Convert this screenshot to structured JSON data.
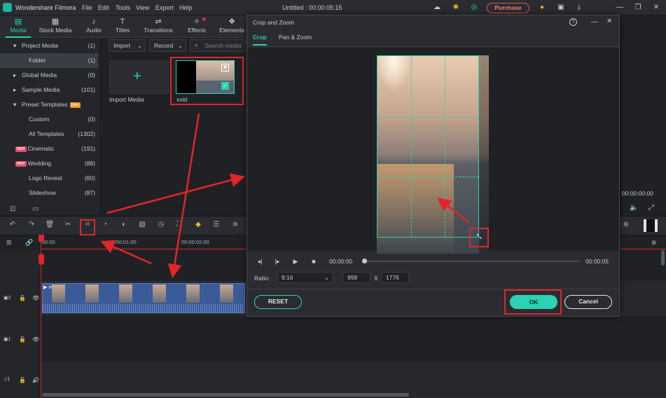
{
  "app": {
    "name": "Wondershare Filmora",
    "title": "Untitled : 00:00:05:15",
    "purchase": "Purchase"
  },
  "menu": [
    "File",
    "Edit",
    "Tools",
    "View",
    "Export",
    "Help"
  ],
  "tabs": [
    {
      "label": "Media",
      "icon": "folder-icon"
    },
    {
      "label": "Stock Media",
      "icon": "stock-icon"
    },
    {
      "label": "Audio",
      "icon": "music-icon"
    },
    {
      "label": "Titles",
      "icon": "text-icon"
    },
    {
      "label": "Transitions",
      "icon": "transition-icon"
    },
    {
      "label": "Effects",
      "icon": "effects-icon"
    },
    {
      "label": "Elements",
      "icon": "elements-icon"
    }
  ],
  "sidebar": [
    {
      "label": "Project Media",
      "count": "(1)"
    },
    {
      "label": "Folder",
      "count": "(1)"
    },
    {
      "label": "Global Media",
      "count": "(0)"
    },
    {
      "label": "Sample Media",
      "count": "(101)"
    },
    {
      "label": "Preset Templates",
      "count": "",
      "badge": "New"
    },
    {
      "label": "Custom",
      "count": "(0)"
    },
    {
      "label": "All Templates",
      "count": "(1302)"
    },
    {
      "label": "Cinematic",
      "count": "(191)",
      "badge": "HOT"
    },
    {
      "label": "Wedding",
      "count": "(88)",
      "badge": "HOT"
    },
    {
      "label": "Logo Reveal",
      "count": "(60)"
    },
    {
      "label": "Slideshow",
      "count": "(87)"
    }
  ],
  "media": {
    "import_label": "Import",
    "record_label": "Record",
    "search_placeholder": "Search media",
    "import_tile": "Import Media",
    "clip_name": "xvid"
  },
  "preview": {
    "time": "00:00:00:00"
  },
  "timeline": {
    "marks": [
      "00:00",
      "00:00:01:00",
      "00:00:02:00"
    ],
    "clip_name": "xvid",
    "tracks": [
      "2",
      "1",
      "1"
    ]
  },
  "dialog": {
    "title": "Crop and Zoom",
    "tab_crop": "Crop",
    "tab_pan": "Pan & Zoom",
    "time_start": "00:00:00",
    "time_end": "00:00:05",
    "ratio_label": "Ratio:",
    "ratio_value": "9:16",
    "width": "999",
    "x_sep": "X",
    "height": "1776",
    "reset": "RESET",
    "ok": "OK",
    "cancel": "Cancel"
  },
  "colors": {
    "accent": "#2bd2b3",
    "highlight": "#e0262a",
    "clip": "#3a5a99"
  }
}
